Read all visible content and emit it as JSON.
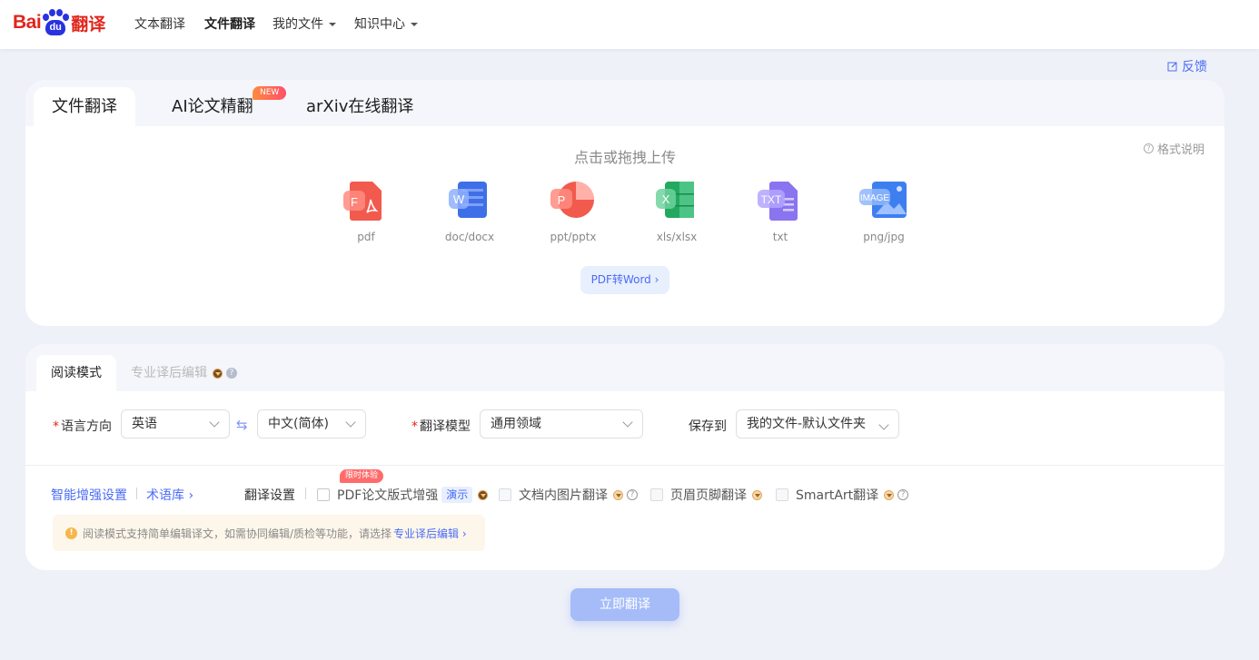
{
  "header": {
    "logo": {
      "bai": "Bai",
      "du": "du",
      "fanyi": "翻译"
    },
    "nav": [
      {
        "label": "文本翻译",
        "active": false,
        "dropdown": false
      },
      {
        "label": "文件翻译",
        "active": true,
        "dropdown": false
      },
      {
        "label": "我的文件",
        "active": false,
        "dropdown": true
      },
      {
        "label": "知识中心",
        "active": false,
        "dropdown": true
      }
    ]
  },
  "feedback_label": "反馈",
  "upload_card": {
    "tabs": [
      {
        "label": "文件翻译",
        "active": true
      },
      {
        "label": "AI论文精翻",
        "active": false,
        "badge": "NEW"
      },
      {
        "label": "arXiv在线翻译",
        "active": false
      }
    ],
    "format_note": "格式说明",
    "upload_hint": "点击或拖拽上传",
    "file_types": [
      {
        "label": "pdf",
        "icon": "pdf-icon",
        "letter": "F",
        "color": "#f25a4e"
      },
      {
        "label": "doc/docx",
        "icon": "word-icon",
        "letter": "W",
        "color": "#3e6fe8"
      },
      {
        "label": "ppt/pptx",
        "icon": "ppt-icon",
        "letter": "P",
        "color": "#f25a4e"
      },
      {
        "label": "xls/xlsx",
        "icon": "excel-icon",
        "letter": "X",
        "color": "#23a860"
      },
      {
        "label": "txt",
        "icon": "txt-icon",
        "letter": "TXT",
        "color": "#8a74f0"
      },
      {
        "label": "png/jpg",
        "icon": "image-icon",
        "letter": "IMAGE",
        "color": "#3e7ff0"
      }
    ],
    "pdf_to_word": "PDF转Word"
  },
  "settings_card": {
    "tabs": [
      {
        "label": "阅读模式",
        "active": true
      },
      {
        "label": "专业译后编辑",
        "active": false
      }
    ],
    "language_direction": {
      "label": "语言方向",
      "source": "英语",
      "target": "中文(简体)"
    },
    "model": {
      "label": "翻译模型",
      "value": "通用领域"
    },
    "save_to": {
      "label": "保存到",
      "value": "我的文件-默认文件夹"
    },
    "links": {
      "smart": "智能增强设置",
      "glossary": "术语库"
    },
    "translate_settings_label": "翻译设置",
    "limited_badge": "限时体验",
    "options": [
      {
        "label": "PDF论文版式增强",
        "demo": "演示"
      },
      {
        "label": "文档内图片翻译"
      },
      {
        "label": "页眉页脚翻译"
      },
      {
        "label": "SmartArt翻译"
      }
    ],
    "notice": {
      "text": "阅读模式支持简单编辑译文，如需协同编辑/质检等功能，请选择",
      "link": "专业译后编辑"
    }
  },
  "translate_button": "立即翻译",
  "colors": {
    "brand_red": "#e1251b",
    "brand_blue": "#2932e1",
    "accent": "#4a6cf7"
  }
}
